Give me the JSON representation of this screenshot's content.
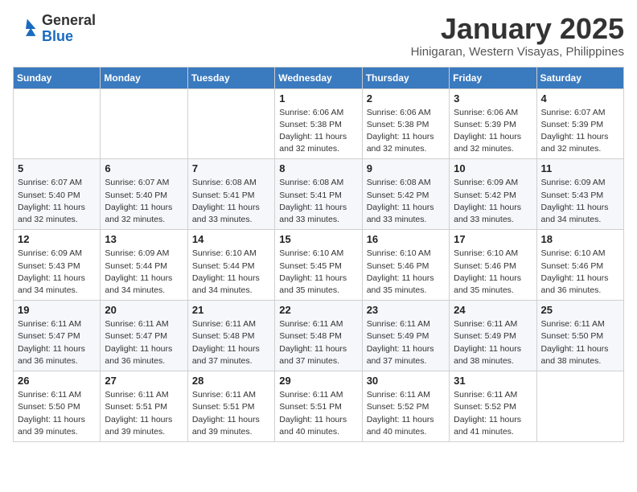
{
  "logo": {
    "general": "General",
    "blue": "Blue"
  },
  "header": {
    "month": "January 2025",
    "location": "Hinigaran, Western Visayas, Philippines"
  },
  "weekdays": [
    "Sunday",
    "Monday",
    "Tuesday",
    "Wednesday",
    "Thursday",
    "Friday",
    "Saturday"
  ],
  "weeks": [
    [
      {
        "day": "",
        "info": ""
      },
      {
        "day": "",
        "info": ""
      },
      {
        "day": "",
        "info": ""
      },
      {
        "day": "1",
        "info": "Sunrise: 6:06 AM\nSunset: 5:38 PM\nDaylight: 11 hours and 32 minutes."
      },
      {
        "day": "2",
        "info": "Sunrise: 6:06 AM\nSunset: 5:38 PM\nDaylight: 11 hours and 32 minutes."
      },
      {
        "day": "3",
        "info": "Sunrise: 6:06 AM\nSunset: 5:39 PM\nDaylight: 11 hours and 32 minutes."
      },
      {
        "day": "4",
        "info": "Sunrise: 6:07 AM\nSunset: 5:39 PM\nDaylight: 11 hours and 32 minutes."
      }
    ],
    [
      {
        "day": "5",
        "info": "Sunrise: 6:07 AM\nSunset: 5:40 PM\nDaylight: 11 hours and 32 minutes."
      },
      {
        "day": "6",
        "info": "Sunrise: 6:07 AM\nSunset: 5:40 PM\nDaylight: 11 hours and 32 minutes."
      },
      {
        "day": "7",
        "info": "Sunrise: 6:08 AM\nSunset: 5:41 PM\nDaylight: 11 hours and 33 minutes."
      },
      {
        "day": "8",
        "info": "Sunrise: 6:08 AM\nSunset: 5:41 PM\nDaylight: 11 hours and 33 minutes."
      },
      {
        "day": "9",
        "info": "Sunrise: 6:08 AM\nSunset: 5:42 PM\nDaylight: 11 hours and 33 minutes."
      },
      {
        "day": "10",
        "info": "Sunrise: 6:09 AM\nSunset: 5:42 PM\nDaylight: 11 hours and 33 minutes."
      },
      {
        "day": "11",
        "info": "Sunrise: 6:09 AM\nSunset: 5:43 PM\nDaylight: 11 hours and 34 minutes."
      }
    ],
    [
      {
        "day": "12",
        "info": "Sunrise: 6:09 AM\nSunset: 5:43 PM\nDaylight: 11 hours and 34 minutes."
      },
      {
        "day": "13",
        "info": "Sunrise: 6:09 AM\nSunset: 5:44 PM\nDaylight: 11 hours and 34 minutes."
      },
      {
        "day": "14",
        "info": "Sunrise: 6:10 AM\nSunset: 5:44 PM\nDaylight: 11 hours and 34 minutes."
      },
      {
        "day": "15",
        "info": "Sunrise: 6:10 AM\nSunset: 5:45 PM\nDaylight: 11 hours and 35 minutes."
      },
      {
        "day": "16",
        "info": "Sunrise: 6:10 AM\nSunset: 5:46 PM\nDaylight: 11 hours and 35 minutes."
      },
      {
        "day": "17",
        "info": "Sunrise: 6:10 AM\nSunset: 5:46 PM\nDaylight: 11 hours and 35 minutes."
      },
      {
        "day": "18",
        "info": "Sunrise: 6:10 AM\nSunset: 5:46 PM\nDaylight: 11 hours and 36 minutes."
      }
    ],
    [
      {
        "day": "19",
        "info": "Sunrise: 6:11 AM\nSunset: 5:47 PM\nDaylight: 11 hours and 36 minutes."
      },
      {
        "day": "20",
        "info": "Sunrise: 6:11 AM\nSunset: 5:47 PM\nDaylight: 11 hours and 36 minutes."
      },
      {
        "day": "21",
        "info": "Sunrise: 6:11 AM\nSunset: 5:48 PM\nDaylight: 11 hours and 37 minutes."
      },
      {
        "day": "22",
        "info": "Sunrise: 6:11 AM\nSunset: 5:48 PM\nDaylight: 11 hours and 37 minutes."
      },
      {
        "day": "23",
        "info": "Sunrise: 6:11 AM\nSunset: 5:49 PM\nDaylight: 11 hours and 37 minutes."
      },
      {
        "day": "24",
        "info": "Sunrise: 6:11 AM\nSunset: 5:49 PM\nDaylight: 11 hours and 38 minutes."
      },
      {
        "day": "25",
        "info": "Sunrise: 6:11 AM\nSunset: 5:50 PM\nDaylight: 11 hours and 38 minutes."
      }
    ],
    [
      {
        "day": "26",
        "info": "Sunrise: 6:11 AM\nSunset: 5:50 PM\nDaylight: 11 hours and 39 minutes."
      },
      {
        "day": "27",
        "info": "Sunrise: 6:11 AM\nSunset: 5:51 PM\nDaylight: 11 hours and 39 minutes."
      },
      {
        "day": "28",
        "info": "Sunrise: 6:11 AM\nSunset: 5:51 PM\nDaylight: 11 hours and 39 minutes."
      },
      {
        "day": "29",
        "info": "Sunrise: 6:11 AM\nSunset: 5:51 PM\nDaylight: 11 hours and 40 minutes."
      },
      {
        "day": "30",
        "info": "Sunrise: 6:11 AM\nSunset: 5:52 PM\nDaylight: 11 hours and 40 minutes."
      },
      {
        "day": "31",
        "info": "Sunrise: 6:11 AM\nSunset: 5:52 PM\nDaylight: 11 hours and 41 minutes."
      },
      {
        "day": "",
        "info": ""
      }
    ]
  ]
}
